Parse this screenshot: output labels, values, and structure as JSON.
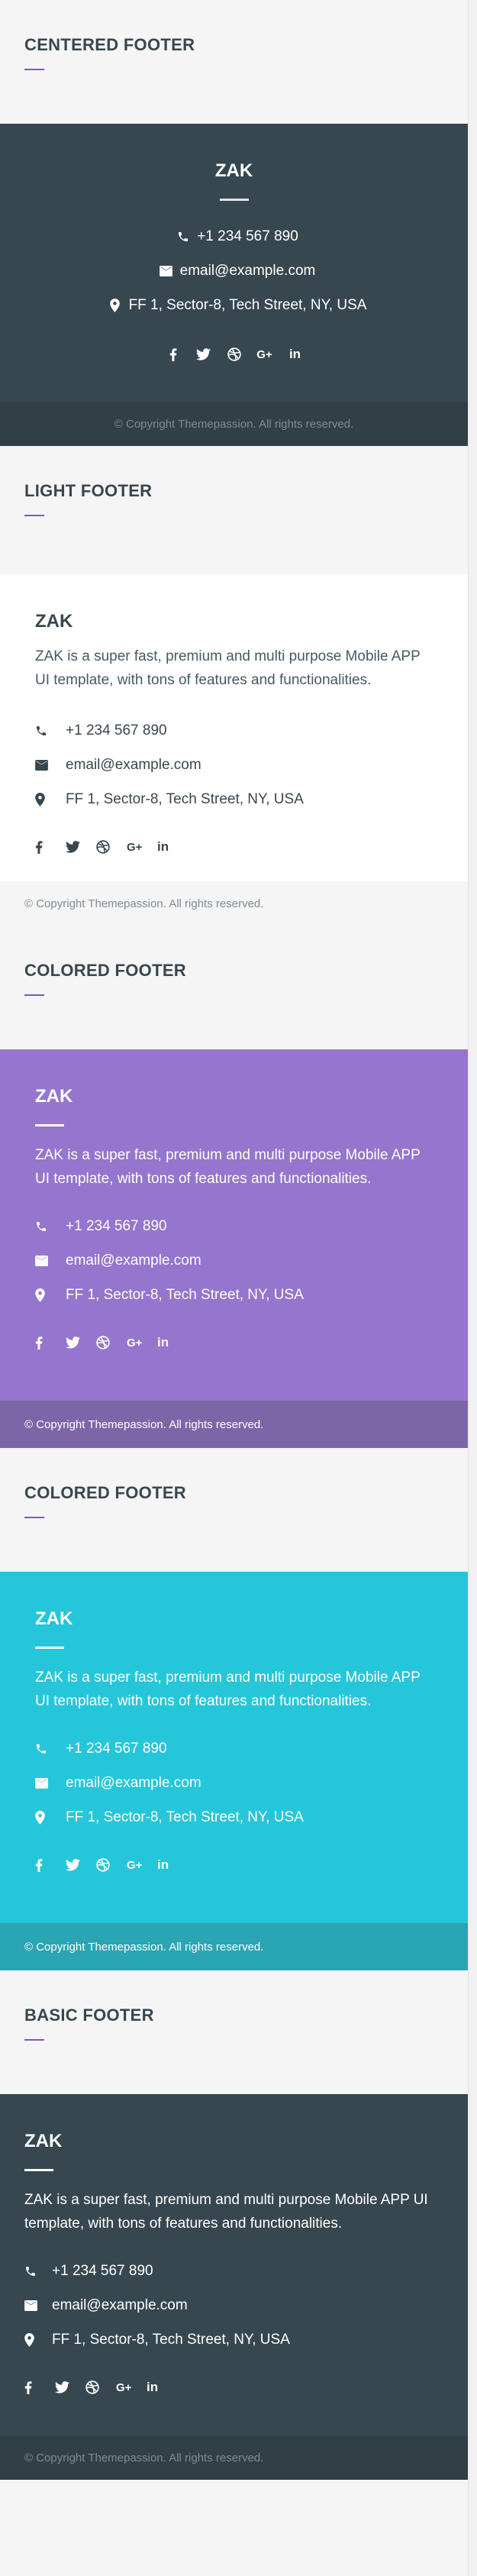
{
  "sections": {
    "centered": {
      "title": "CENTERED FOOTER"
    },
    "light": {
      "title": "LIGHT FOOTER"
    },
    "colored1": {
      "title": "COLORED FOOTER"
    },
    "colored2": {
      "title": "COLORED FOOTER"
    },
    "basic": {
      "title": "BASIC FOOTER"
    }
  },
  "footer": {
    "brand": "ZAK",
    "description": "ZAK is a super fast, premium and multi purpose Mobile APP UI template, with tons of features and functionalities.",
    "phone": "+1 234 567 890",
    "email": "email@example.com",
    "address": "FF 1, Sector-8, Tech Street, NY, USA",
    "copyright": "© Copyright Themepassion. All rights reserved.",
    "social_icons": [
      "facebook-icon",
      "twitter-icon",
      "dribbble-icon",
      "google-plus-icon",
      "linkedin-icon"
    ],
    "google_plus_text": "G+",
    "linkedin_text": "in"
  },
  "colors": {
    "dark": "#37474f",
    "purple": "#9575cd",
    "cyan": "#26c6da",
    "accent": "#7e57c2",
    "light": "#ffffff"
  }
}
